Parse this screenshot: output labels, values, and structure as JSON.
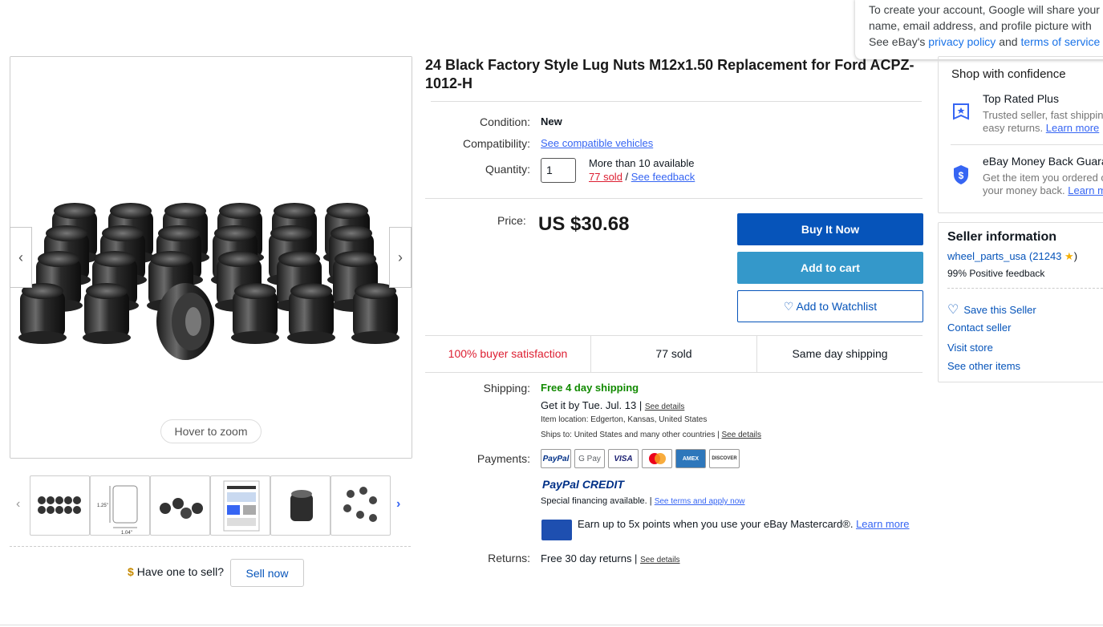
{
  "google_popup": {
    "line1": "To create your account, Google will share your",
    "line2": "name, email address, and profile picture with",
    "line3_prefix": "See eBay's ",
    "privacy_link": "privacy policy",
    "and": " and ",
    "terms_link": "terms of service"
  },
  "gallery": {
    "hover_zoom": "Hover to zoom",
    "thumb_labels": [
      "1.25\"",
      "1.04\""
    ]
  },
  "sell": {
    "question": "Have one to sell?",
    "button": "Sell now"
  },
  "product": {
    "title": "24 Black Factory Style Lug Nuts M12x1.50 Replacement for Ford ACPZ-1012-H",
    "condition_label": "Condition:",
    "condition_value": "New",
    "compat_label": "Compatibility:",
    "compat_link": "See compatible vehicles",
    "qty_label": "Quantity:",
    "qty_value": "1",
    "availability": "More than 10 available",
    "sold_link": "77 sold",
    "slash": " / ",
    "feedback_link": "See feedback",
    "price_label": "Price:",
    "price": "US $30.68"
  },
  "actions": {
    "buy_now": "Buy It Now",
    "add_to_cart": "Add to cart",
    "watchlist": "♡ Add to Watchlist"
  },
  "stats": {
    "satisfaction": "100% buyer satisfaction",
    "sold": "77 sold",
    "shipping": "Same day shipping"
  },
  "shipping": {
    "label": "Shipping:",
    "free": "Free 4 day shipping",
    "get_it": "Get it by Tue. Jul. 13 |",
    "see_details": "See details",
    "location": "Item location:  Edgerton, Kansas, United States",
    "ships_to": "Ships to:  United States and many other countries |",
    "see_details2": "See details"
  },
  "payments": {
    "label": "Payments:",
    "logos": [
      "PayPal",
      "G Pay",
      "VISA",
      "MC",
      "AMEX",
      "DISCOVER"
    ],
    "paypal_credit": "PayPal CREDIT",
    "financing": "Special financing available.  |",
    "terms_link": "See terms and apply now",
    "mastercard_text": "Earn up to 5x points when you use your eBay Mastercard®.",
    "learn_more": "Learn more"
  },
  "returns": {
    "label": "Returns:",
    "value": "Free 30 day returns |",
    "see_details": "See details"
  },
  "confidence": {
    "title": "Shop with confidence",
    "item1_title": "Top Rated Plus",
    "item1_line1": "Trusted seller, fast shipping, and",
    "item1_line2": "easy returns.",
    "item1_link": "Learn more",
    "item2_title": "eBay Money Back Guarantee",
    "item2_line1": "Get the item you ordered or get",
    "item2_line2": "your money back.",
    "item2_link": "Learn more"
  },
  "seller": {
    "title": "Seller information",
    "name": "wheel_parts_usa",
    "rating": "21243",
    "positive": "99% Positive feedback",
    "save": "Save this Seller",
    "contact": "Contact seller",
    "store": "Visit store",
    "other": "See other items"
  },
  "colors": {
    "brand_blue": "#0654ba",
    "link_blue": "#3665f3",
    "red": "#dd1e31",
    "green": "#118a00"
  }
}
